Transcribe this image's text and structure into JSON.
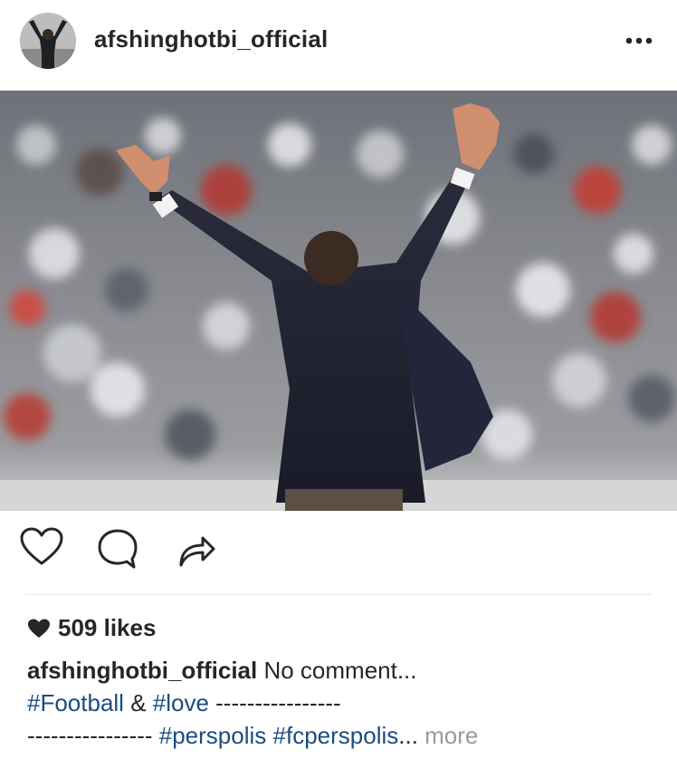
{
  "post": {
    "username": "afshinghotbi_official",
    "more_icon": "more-horizontal-icon",
    "likes_text": "509 likes",
    "caption": {
      "username": "afshinghotbi_official",
      "text": " No comment...",
      "tag_football": "#Football",
      "amp": " & ",
      "tag_love": "#love",
      "dashes1": " ----------------",
      "dashes2": "---------------- ",
      "tag_perspolis": "#perspolis",
      "space": " ",
      "tag_fcperspolis": "#fcperspolis",
      "ellipsis": "...",
      "more": " more"
    }
  },
  "icons": {
    "like": "heart-outline-icon",
    "comment": "comment-bubble-icon",
    "share": "share-arrow-icon",
    "likes_heart": "heart-filled-icon"
  },
  "colors": {
    "text": "#262626",
    "hashtag": "#1b4d7e",
    "muted": "#9a9a9a",
    "divider": "#e6e6e6"
  }
}
